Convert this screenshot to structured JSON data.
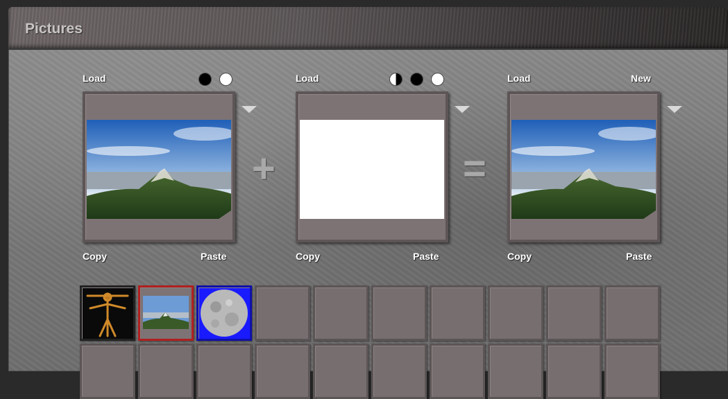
{
  "title": "Pictures",
  "slots": [
    {
      "load_label": "Load",
      "copy_label": "Copy",
      "paste_label": "Paste",
      "content": "mountain-landscape"
    },
    {
      "load_label": "Load",
      "copy_label": "Copy",
      "paste_label": "Paste",
      "content": "blank-white"
    },
    {
      "load_label": "Load",
      "new_label": "New",
      "copy_label": "Copy",
      "paste_label": "Paste",
      "content": "mountain-landscape"
    }
  ],
  "operators": {
    "plus": "+",
    "equals": "="
  },
  "thumbnails": [
    {
      "content": "vitruvian-man",
      "selected": false
    },
    {
      "content": "mountain-landscape",
      "selected": true
    },
    {
      "content": "moon",
      "selected": false
    },
    {
      "content": "empty"
    },
    {
      "content": "empty"
    },
    {
      "content": "empty"
    },
    {
      "content": "empty"
    },
    {
      "content": "empty"
    },
    {
      "content": "empty"
    },
    {
      "content": "empty"
    }
  ],
  "colors": {
    "selected_border": "#b02020",
    "moon_background": "#1a1aff"
  }
}
